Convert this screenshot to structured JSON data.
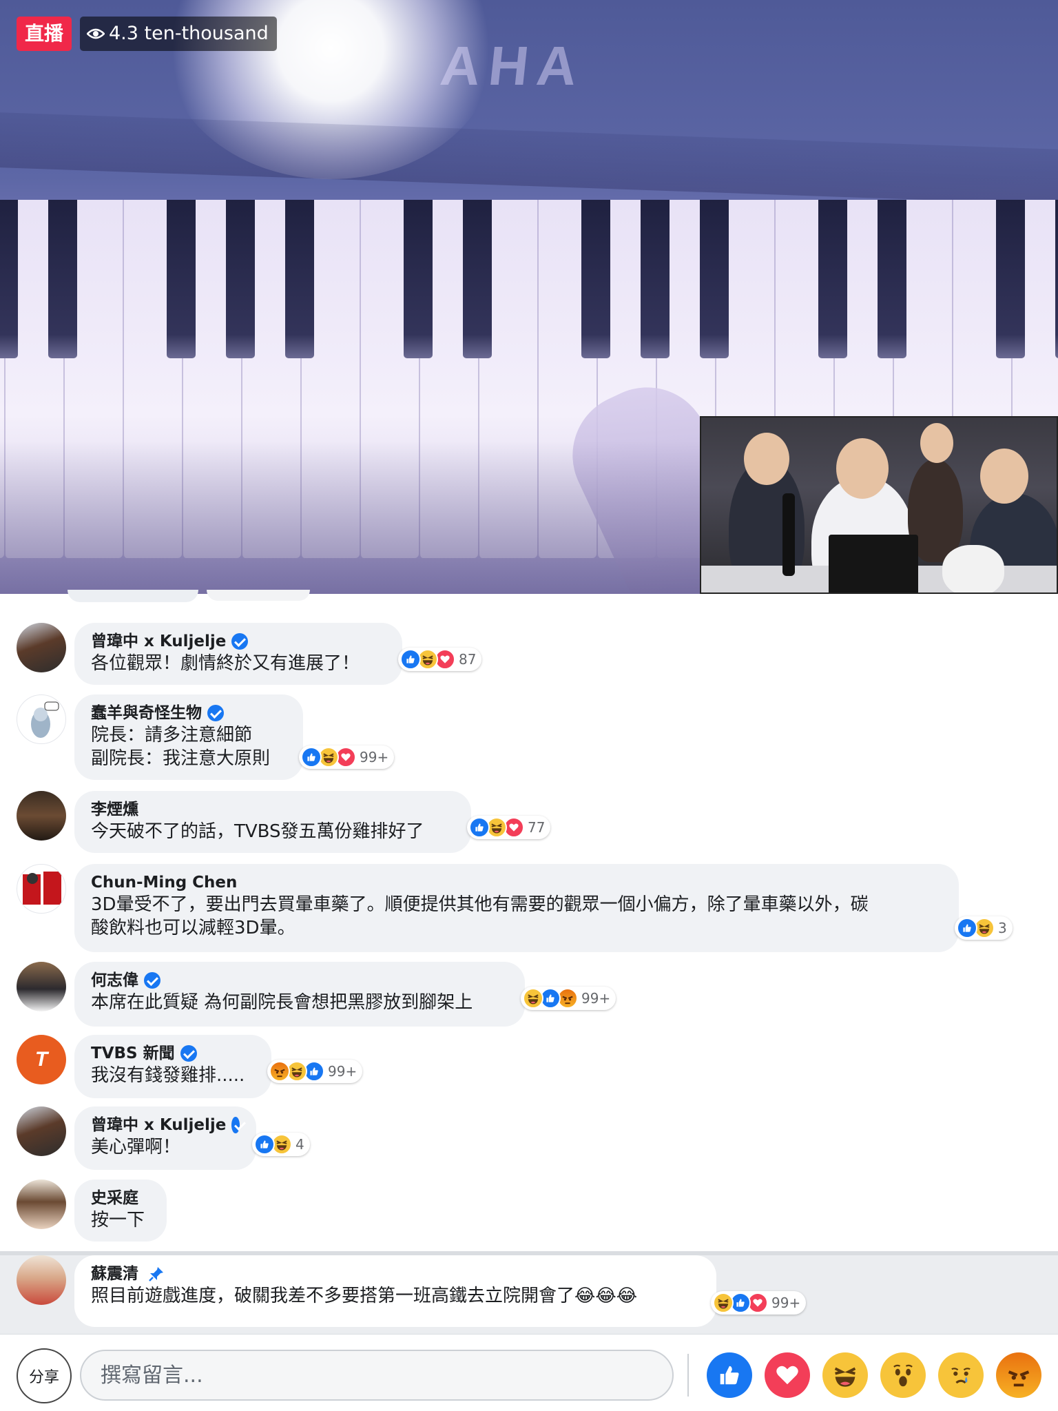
{
  "video": {
    "live_label": "直播",
    "viewer_count": "4.3 ten-thousand"
  },
  "comments": [
    {
      "name": "曾瑋中 x Kuljelje",
      "verified": true,
      "lines": [
        "各位觀眾！劇情終於又有進展了！"
      ],
      "reactions": [
        "like-icon",
        "haha-icon",
        "love-icon"
      ],
      "count": "87"
    },
    {
      "name": "蠢羊與奇怪生物",
      "verified": true,
      "lines": [
        "院長：請多注意細節",
        "副院長：我注意大原則"
      ],
      "reactions": [
        "like-icon",
        "haha-icon",
        "love-icon"
      ],
      "count": "99+"
    },
    {
      "name": "李煙燻",
      "verified": false,
      "lines": [
        "今天破不了的話，TVBS發五萬份雞排好了"
      ],
      "reactions": [
        "like-icon",
        "haha-icon",
        "love-icon"
      ],
      "count": "77"
    },
    {
      "name": "Chun-Ming Chen",
      "verified": false,
      "lines": [
        "3D暈受不了，要出門去買暈車藥了。順便提供其他有需要的觀眾一個小偏方，除了暈車藥以外，碳",
        "酸飲料也可以減輕3D暈。"
      ],
      "reactions": [
        "like-icon",
        "haha-icon"
      ],
      "count": "3"
    },
    {
      "name": "何志偉",
      "verified": true,
      "lines": [
        "本席在此質疑 為何副院長會想把黑膠放到腳架上"
      ],
      "reactions": [
        "haha-icon",
        "like-icon",
        "angry-icon"
      ],
      "count": "99+"
    },
    {
      "name": "TVBS 新聞",
      "verified": true,
      "lines": [
        "我沒有錢發雞排....."
      ],
      "reactions": [
        "angry-icon",
        "haha-icon",
        "like-icon"
      ],
      "count": "99+"
    },
    {
      "name": "曾瑋中 x Kuljelje",
      "verified": true,
      "lines": [
        "美心彈啊！"
      ],
      "reactions": [
        "like-icon",
        "haha-icon"
      ],
      "count": "4"
    },
    {
      "name": "史采庭",
      "verified": false,
      "lines": [
        "按一下"
      ],
      "reactions": [],
      "count": ""
    }
  ],
  "pinned": {
    "name": "蘇震清",
    "text": "照目前遊戲進度，破關我差不多要搭第一班高鐵去立院開會了😂😂😂",
    "reactions": [
      "haha-icon",
      "like-icon",
      "love-icon"
    ],
    "count": "99+"
  },
  "bottom_bar": {
    "share_label": "分享",
    "comment_placeholder": "撰寫留言...",
    "reaction_buttons": [
      "like-icon",
      "love-icon",
      "haha-icon",
      "wow-icon",
      "sad-icon",
      "angry-icon"
    ]
  },
  "colors": {
    "live_red": "#f02849",
    "like_blue": "#1877f2",
    "love_red": "#f33e58",
    "haha_yellow": "#f7c43a",
    "bubble_gray": "#f0f2f5",
    "pinned_bg": "#ebedf0"
  }
}
